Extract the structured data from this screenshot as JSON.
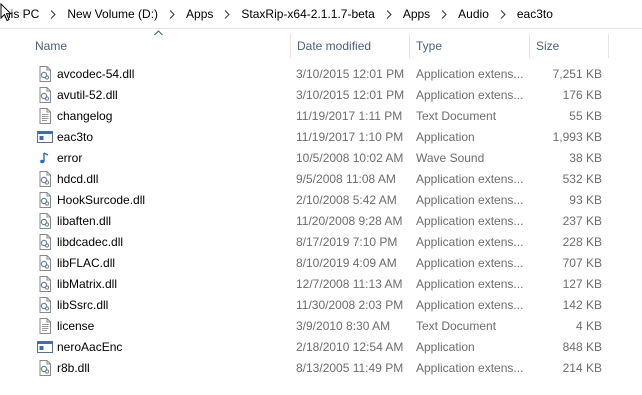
{
  "breadcrumb": {
    "items": [
      "his PC",
      "New Volume (D:)",
      "Apps",
      "StaxRip-x64-2.1.1.7-beta",
      "Apps",
      "Audio",
      "eac3to"
    ]
  },
  "columns": {
    "name": "Name",
    "date": "Date modified",
    "type": "Type",
    "size": "Size"
  },
  "colors": {
    "header_text": "#4c607a",
    "detail_text": "#6d6d6d"
  },
  "files": [
    {
      "name": "avcodec-54.dll",
      "date": "3/10/2015 12:01 PM",
      "type": "Application extens...",
      "size": "7,251 KB",
      "icon": "dll-icon"
    },
    {
      "name": "avutil-52.dll",
      "date": "3/10/2015 12:01 PM",
      "type": "Application extens...",
      "size": "176 KB",
      "icon": "dll-icon"
    },
    {
      "name": "changelog",
      "date": "11/19/2017 1:11 PM",
      "type": "Text Document",
      "size": "55 KB",
      "icon": "text-document-icon"
    },
    {
      "name": "eac3to",
      "date": "11/19/2017 1:10 PM",
      "type": "Application",
      "size": "1,993 KB",
      "icon": "application-icon"
    },
    {
      "name": "error",
      "date": "10/5/2008 10:02 AM",
      "type": "Wave Sound",
      "size": "38 KB",
      "icon": "wave-sound-icon"
    },
    {
      "name": "hdcd.dll",
      "date": "9/5/2008 11:08 AM",
      "type": "Application extens...",
      "size": "532 KB",
      "icon": "dll-icon"
    },
    {
      "name": "HookSurcode.dll",
      "date": "2/10/2008 5:42 AM",
      "type": "Application extens...",
      "size": "93 KB",
      "icon": "dll-icon"
    },
    {
      "name": "libaften.dll",
      "date": "11/20/2008 9:28 AM",
      "type": "Application extens...",
      "size": "237 KB",
      "icon": "dll-icon"
    },
    {
      "name": "libdcadec.dll",
      "date": "8/17/2019 7:10 PM",
      "type": "Application extens...",
      "size": "228 KB",
      "icon": "dll-icon"
    },
    {
      "name": "libFLAC.dll",
      "date": "8/10/2019 4:09 AM",
      "type": "Application extens...",
      "size": "707 KB",
      "icon": "dll-icon"
    },
    {
      "name": "libMatrix.dll",
      "date": "12/7/2008 11:13 AM",
      "type": "Application extens...",
      "size": "127 KB",
      "icon": "dll-icon"
    },
    {
      "name": "libSsrc.dll",
      "date": "11/30/2008 2:03 PM",
      "type": "Application extens...",
      "size": "142 KB",
      "icon": "dll-icon"
    },
    {
      "name": "license",
      "date": "3/9/2010 8:30 AM",
      "type": "Text Document",
      "size": "4 KB",
      "icon": "text-document-icon"
    },
    {
      "name": "neroAacEnc",
      "date": "2/18/2010 12:54 AM",
      "type": "Application",
      "size": "848 KB",
      "icon": "application-icon"
    },
    {
      "name": "r8b.dll",
      "date": "8/13/2005 11:49 PM",
      "type": "Application extens...",
      "size": "214 KB",
      "icon": "dll-icon"
    }
  ]
}
